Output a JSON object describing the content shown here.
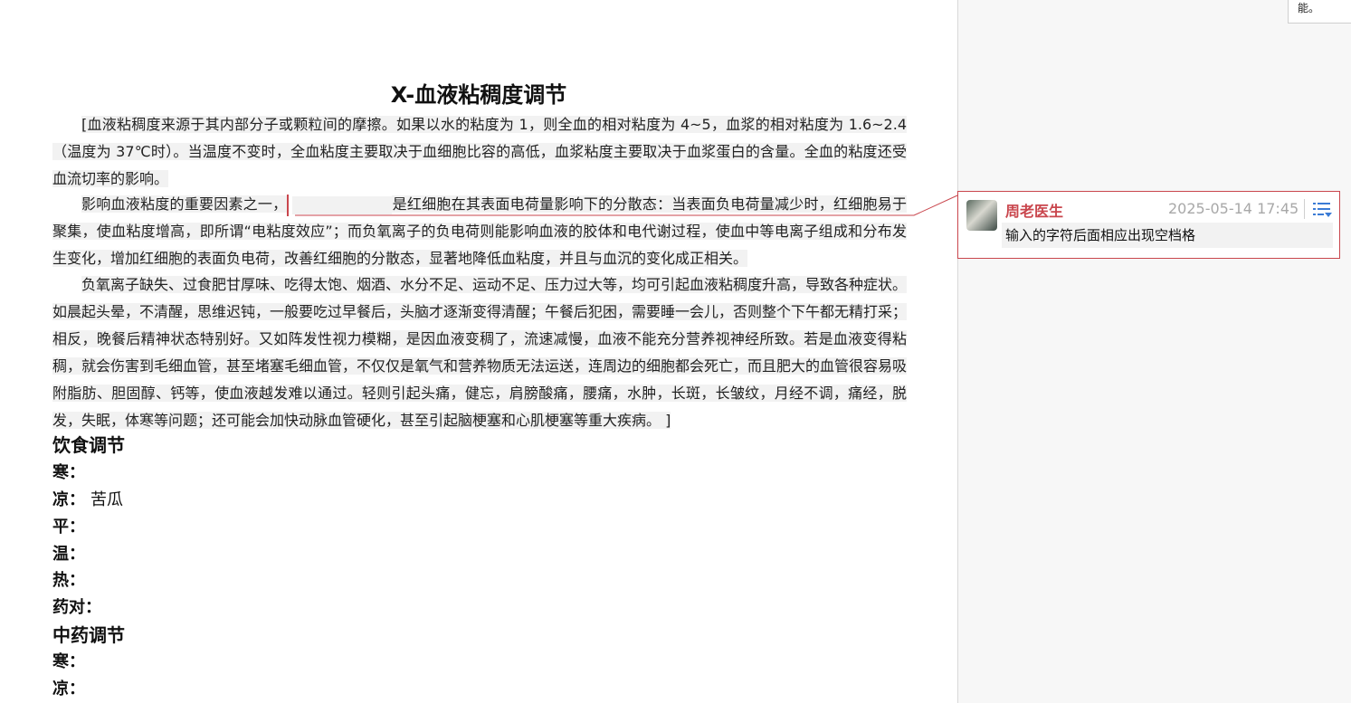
{
  "corner_tip": "能。",
  "doc": {
    "title": "X-血液粘稠度调节",
    "p1": "[血液粘稠度来源于其内部分子或颗粒间的摩擦。如果以水的粘度为 1，则全血的相对粘度为 4~5，血浆的相对粘度为 1.6~2.4（温度为 37℃时）。当温度不变时，全血粘度主要取决于血细胞比容的高低，血浆粘度主要取决于血浆蛋白的含量。全血的粘度还受血流切率的影响。",
    "p2_before": "影响血液粘度的重要因素之一，",
    "p2_after": "是红细胞在其表面电荷量影响下的分散态：当表面负电荷量减少时，红细胞易于聚集，使血粘度增高，即所谓“电粘度效应”；而负氧离子的负电荷则能影响血液的胶体和电代谢过程，使血中等电离子组成和分布发生变化，增加红细胞的表面负电荷，改善红细胞的分散态，显著地降低血粘度，并且与血沉的变化成正相关。",
    "p3": "负氧离子缺失、过食肥甘厚味、吃得太饱、烟酒、水分不足、运动不足、压力过大等，均可引起血液粘稠度升高，导致各种症状。如晨起头晕，不清醒，思维迟钝，一般要吃过早餐后，头脑才逐渐变得清醒；午餐后犯困，需要睡一会儿，否则整个下午都无精打采；相反，晚餐后精神状态特别好。又如阵发性视力模糊，是因血液变稠了，流速减慢，血液不能充分营养视神经所致。若是血液变得粘稠，就会伤害到毛细血管，甚至堵塞毛细血管，不仅仅是氧气和营养物质无法运送，连周边的细胞都会死亡，而且肥大的血管很容易吸附脂肪、胆固醇、钙等，使血液越发难以通过。轻则引起头痛，健忘，肩膀酸痛，腰痛，水肿，长斑，长皱纹，月经不调，痛经，脱发，失眠，体寒等问题；还可能会加快动脉血管硬化，甚至引起脑梗塞和心肌梗塞等重大疾病。 ]",
    "section_diet": "饮食调节",
    "diet_rows": [
      {
        "label": "寒：",
        "value": ""
      },
      {
        "label": "凉：",
        "value": "苦瓜"
      },
      {
        "label": "平：",
        "value": ""
      },
      {
        "label": "温：",
        "value": ""
      },
      {
        "label": "热：",
        "value": ""
      },
      {
        "label": "药对：",
        "value": ""
      }
    ],
    "section_tcm": "中药调节",
    "tcm_rows": [
      {
        "label": "寒：",
        "value": ""
      },
      {
        "label": "凉：",
        "value": ""
      }
    ]
  },
  "comment": {
    "author": "周老医生",
    "time": "2025-05-14 17:45",
    "text": "输入的字符后面相应出现空档格",
    "icon": "menu-icon",
    "accent": "#c9464d"
  }
}
